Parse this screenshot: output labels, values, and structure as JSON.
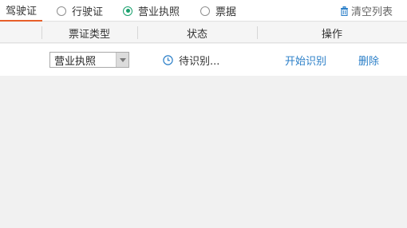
{
  "tabs": {
    "active_tab": "驾驶证",
    "options": [
      {
        "label": "行驶证",
        "checked": false
      },
      {
        "label": "营业执照",
        "checked": true
      },
      {
        "label": "票据",
        "checked": false
      }
    ],
    "clear_label": "清空列表"
  },
  "table": {
    "headers": [
      "票证类型",
      "状态",
      "操作"
    ],
    "rows": [
      {
        "type": "营业执照",
        "status": "待识别...",
        "action_start": "开始识别",
        "action_delete": "删除"
      }
    ]
  },
  "icons": {
    "clear": "trash-icon",
    "status": "clock-icon",
    "select": "chevron-down-icon"
  },
  "colors": {
    "accent": "#e8602a",
    "radio_checked": "#1aa06d",
    "link": "#2b7fc8"
  }
}
